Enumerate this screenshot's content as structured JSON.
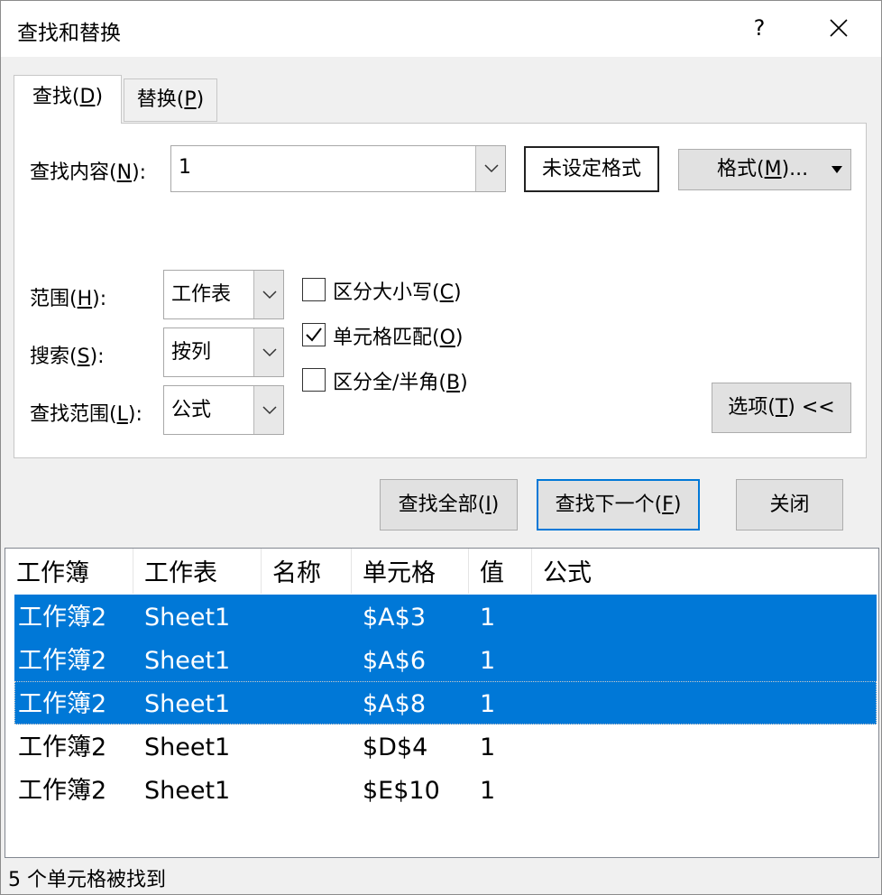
{
  "window": {
    "title": "查找和替换",
    "help_label": "?"
  },
  "tabs": [
    {
      "label": "查找(",
      "accel": "D",
      "suffix": ")"
    },
    {
      "label": "替换(",
      "accel": "P",
      "suffix": ")"
    }
  ],
  "find": {
    "label": "查找内容(",
    "accel": "N",
    "suffix": "):",
    "value": "1",
    "format_preview": "未设定格式",
    "format_button": {
      "label": "格式(",
      "accel": "M",
      "suffix": ")..."
    }
  },
  "options": {
    "within": {
      "label": "范围(",
      "accel": "H",
      "suffix": "):",
      "value": "工作表"
    },
    "search": {
      "label": "搜索(",
      "accel": "S",
      "suffix": "):",
      "value": "按列"
    },
    "look_in": {
      "label": "查找范围(",
      "accel": "L",
      "suffix": "):",
      "value": "公式"
    },
    "match_case": {
      "label": "区分大小写(",
      "accel": "C",
      "suffix": ")",
      "checked": false
    },
    "match_cell": {
      "label": "单元格匹配(",
      "accel": "O",
      "suffix": ")",
      "checked": true
    },
    "match_width": {
      "label": "区分全/半角(",
      "accel": "B",
      "suffix": ")",
      "checked": false
    },
    "options_button": {
      "label": "选项(",
      "accel": "T",
      "suffix": ") <<"
    }
  },
  "actions": {
    "find_all": {
      "label": "查找全部(",
      "accel": "I",
      "suffix": ")"
    },
    "find_next": {
      "label": "查找下一个(",
      "accel": "F",
      "suffix": ")"
    },
    "close": "关闭"
  },
  "results": {
    "columns": [
      "工作簿",
      "工作表",
      "名称",
      "单元格",
      "值",
      "公式"
    ],
    "rows": [
      {
        "workbook": "工作簿2",
        "sheet": "Sheet1",
        "name": "",
        "cell": "$A$3",
        "value": "1",
        "formula": "",
        "selected": true
      },
      {
        "workbook": "工作簿2",
        "sheet": "Sheet1",
        "name": "",
        "cell": "$A$6",
        "value": "1",
        "formula": "",
        "selected": true
      },
      {
        "workbook": "工作簿2",
        "sheet": "Sheet1",
        "name": "",
        "cell": "$A$8",
        "value": "1",
        "formula": "",
        "selected": true
      },
      {
        "workbook": "工作簿2",
        "sheet": "Sheet1",
        "name": "",
        "cell": "$D$4",
        "value": "1",
        "formula": "",
        "selected": false
      },
      {
        "workbook": "工作簿2",
        "sheet": "Sheet1",
        "name": "",
        "cell": "$E$10",
        "value": "1",
        "formula": "",
        "selected": false
      }
    ]
  },
  "status": "5 个单元格被找到",
  "colors": {
    "selection": "#0078d7",
    "focus_border": "#0078d7"
  }
}
